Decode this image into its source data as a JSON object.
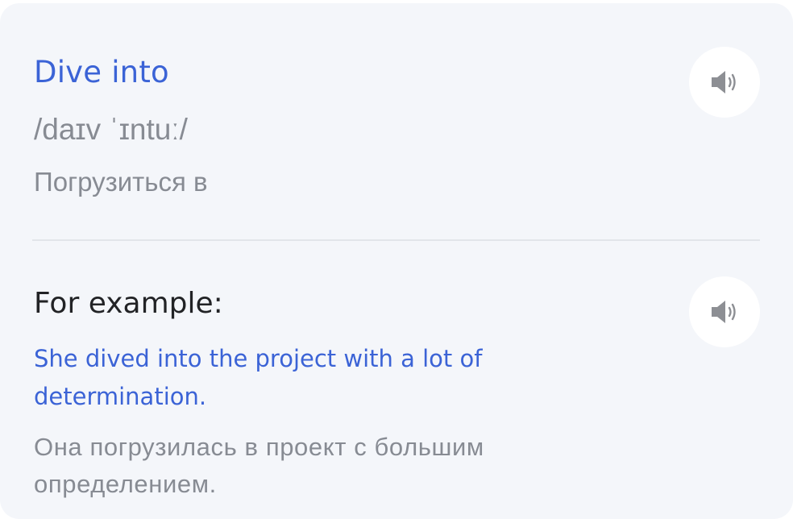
{
  "word_card": {
    "word": "Dive into",
    "transcription": "/daɪv ˈɪntuː/",
    "translation": "Погрузиться в",
    "speaker_icon": "speaker-icon"
  },
  "example": {
    "heading": "For example:",
    "sentence": "She dived into the project with a lot of determination.",
    "translation": "Она погрузилась в проект с большим определением.",
    "speaker_icon": "speaker-icon"
  },
  "colors": {
    "accent": "#3b63d6",
    "secondary_text": "#878b93",
    "card_background": "#f4f6fa"
  }
}
